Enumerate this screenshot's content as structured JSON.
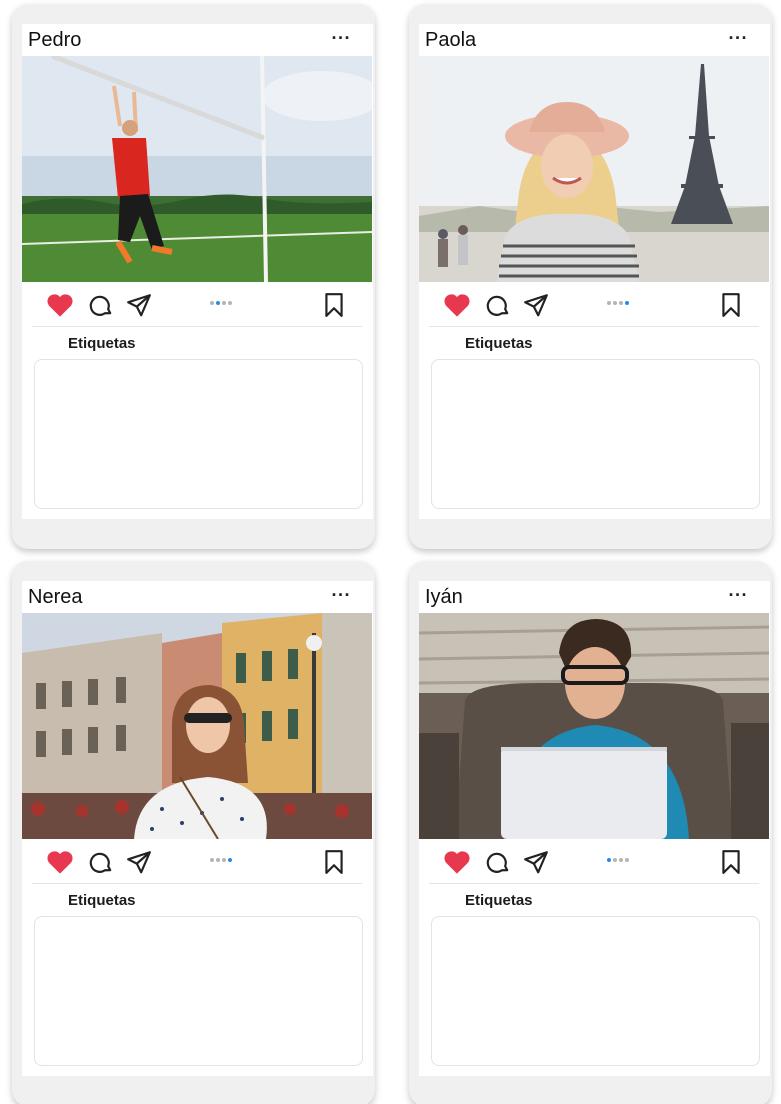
{
  "posts": [
    {
      "username": "Pedro",
      "more_label": "···",
      "photo_alt": "Hombre colgado de una portería en un campo",
      "liked": true,
      "carousel": {
        "count": 4,
        "active": 1
      },
      "tags_label": "Etiquetas",
      "tags_text": ""
    },
    {
      "username": "Paola",
      "more_label": "···",
      "photo_alt": "Mujer con sombrero frente a la Torre Eiffel",
      "liked": true,
      "carousel": {
        "count": 4,
        "active": 3
      },
      "tags_label": "Etiquetas",
      "tags_text": ""
    },
    {
      "username": "Nerea",
      "more_label": "···",
      "photo_alt": "Mujer con gafas de sol en una plaza",
      "liked": true,
      "carousel": {
        "count": 4,
        "active": 3
      },
      "tags_label": "Etiquetas",
      "tags_text": ""
    },
    {
      "username": "Iyán",
      "more_label": "···",
      "photo_alt": "Chico con gafas usando un portátil en un sofá",
      "liked": true,
      "carousel": {
        "count": 4,
        "active": 0
      },
      "tags_label": "Etiquetas",
      "tags_text": ""
    }
  ],
  "icons": {
    "like": "heart-icon",
    "comment": "comment-icon",
    "share": "send-icon",
    "save": "bookmark-icon",
    "more": "more-icon"
  },
  "colors": {
    "heart": "#e8384f",
    "carousel_active": "#2b8be0",
    "carousel_inactive": "#b5b5b5"
  }
}
